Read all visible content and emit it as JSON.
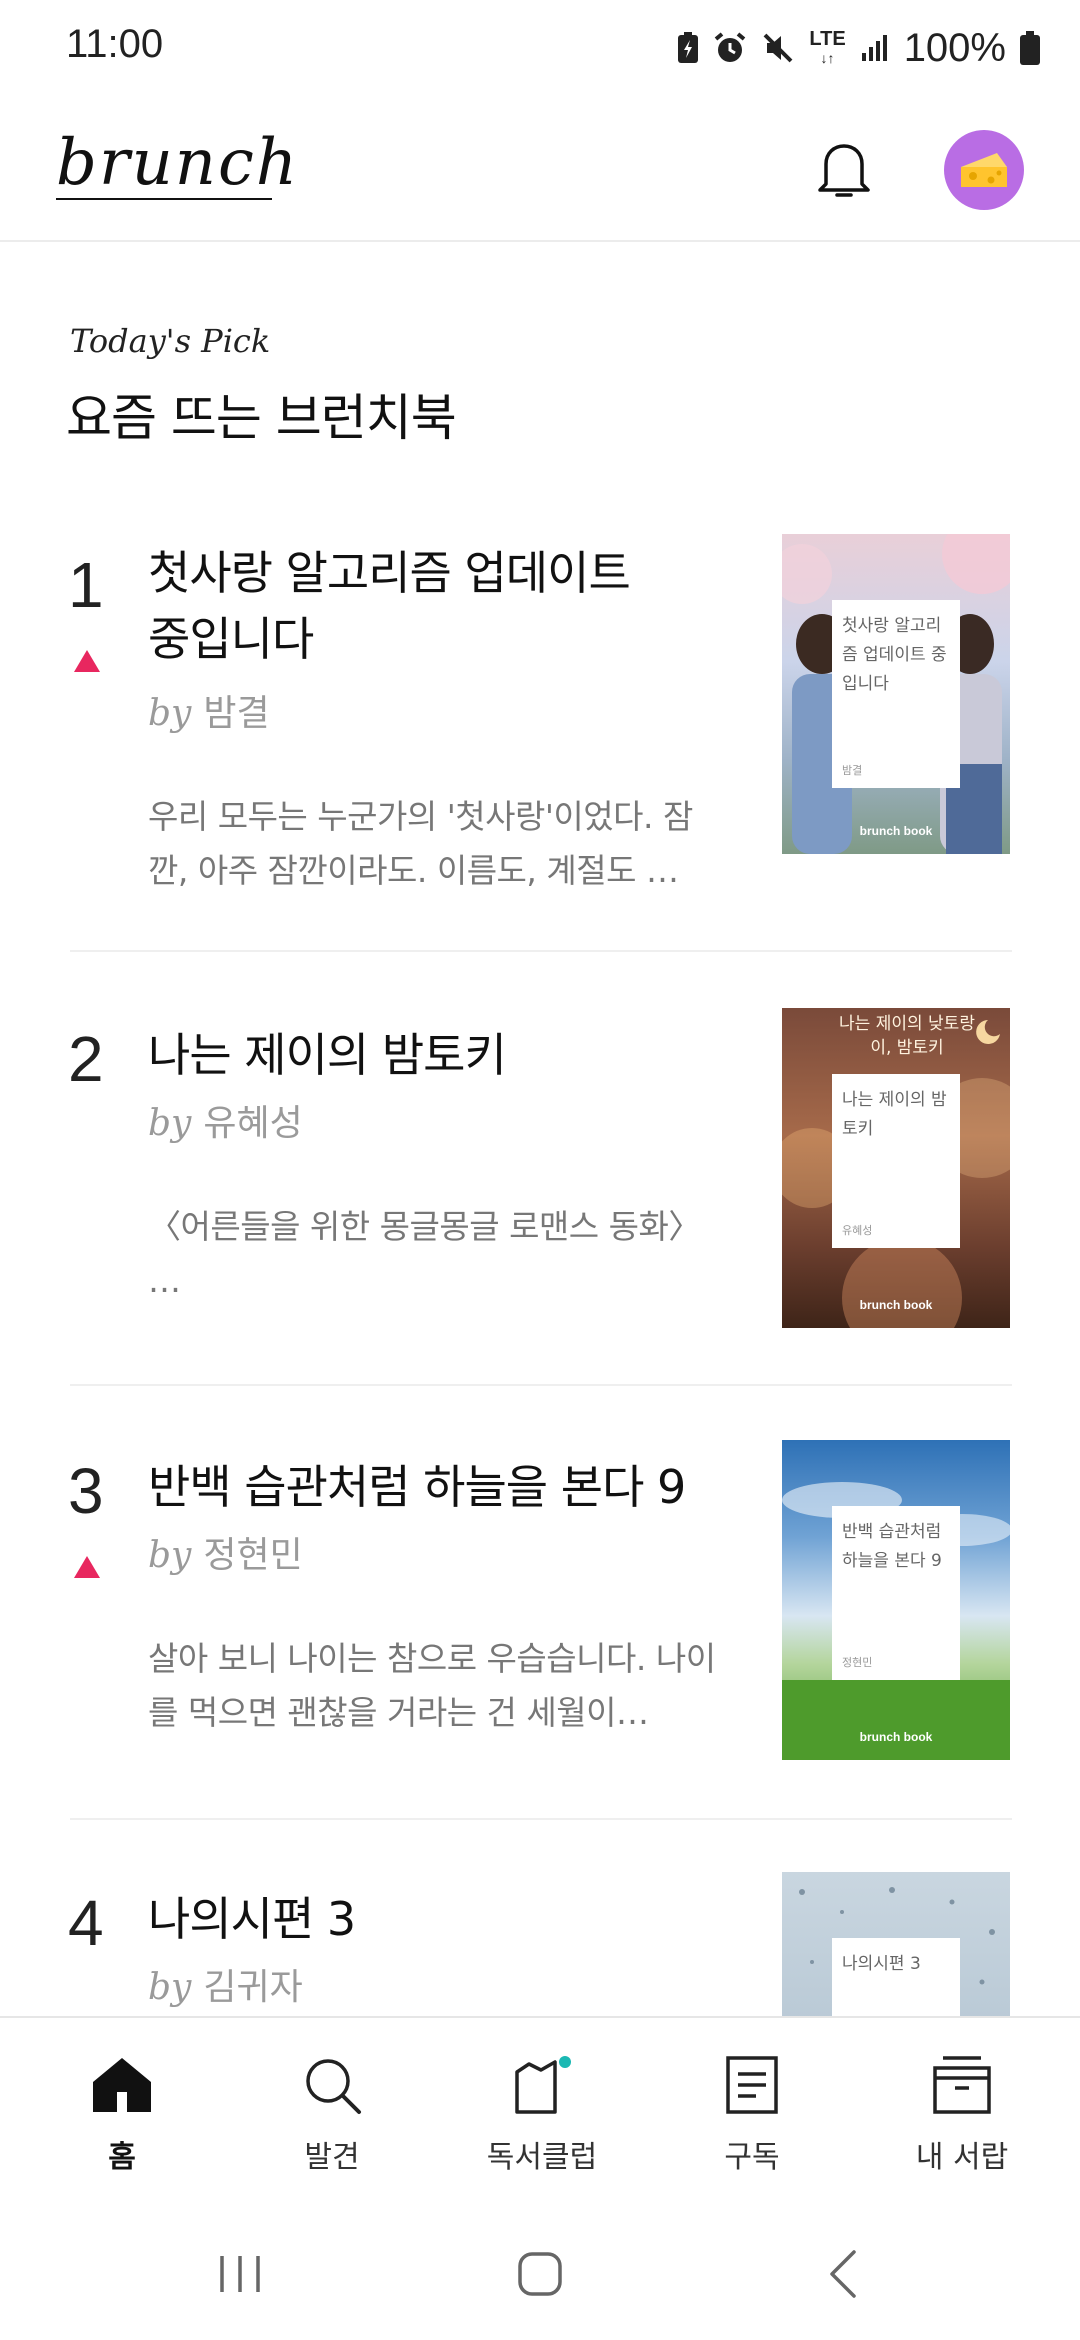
{
  "status_bar": {
    "time": "11:00",
    "network": "LTE",
    "battery": "100%",
    "icons": [
      "battery-saver-icon",
      "alarm-icon",
      "mute-icon",
      "lte-icon",
      "signal-icon",
      "battery-icon"
    ]
  },
  "header": {
    "logo": "brunch",
    "notification_icon": "bell-icon",
    "avatar_icon": "cheese-icon",
    "avatar_color": "#b96de4"
  },
  "section": {
    "label": "Today's Pick",
    "title": "요즘 뜨는 브런치북"
  },
  "items": [
    {
      "rank": "1",
      "trend": "up",
      "title": "첫사랑 알고리즘 업데이트 중입니다",
      "by": "by",
      "author": "밤결",
      "desc": "우리 모두는 누군가의 '첫사랑'이었다. 잠깐, 아주 잠깐이라도. 이름도, 계절도 …",
      "cover_title": "첫사랑 알고리즘 업데이트 중입니다",
      "cover_author": "밤결",
      "cover_publisher": "brunch book"
    },
    {
      "rank": "2",
      "trend": "none",
      "title": "나는 제이의 밤토키",
      "by": "by",
      "author": "유혜성",
      "desc": "〈어른들을 위한 몽글몽글 로맨스 동화〉 …",
      "cover_top_text": "나는 제이의 낮토랑이, 밤토키",
      "cover_title": "나는 제이의 밤토키",
      "cover_author": "유혜성",
      "cover_publisher": "brunch book"
    },
    {
      "rank": "3",
      "trend": "up",
      "title": "반백 습관처럼 하늘을 본다 9",
      "by": "by",
      "author": "정현민",
      "desc": "살아 보니 나이는 참으로 우습습니다. 나이를 먹으면 괜찮을 거라는 건 세월이…",
      "cover_title": "반백 습관처럼 하늘을 본다 9",
      "cover_author": "정현민",
      "cover_publisher": "brunch book"
    },
    {
      "rank": "4",
      "trend": "none",
      "title": "나의시편 3",
      "by": "by",
      "author": "김귀자",
      "cover_title": "나의시편 3"
    }
  ],
  "bottom_nav": [
    {
      "label": "홈",
      "icon": "home-icon",
      "active": true
    },
    {
      "label": "발견",
      "icon": "search-icon",
      "active": false
    },
    {
      "label": "독서클럽",
      "icon": "book-club-icon",
      "active": false
    },
    {
      "label": "구독",
      "icon": "subscribe-icon",
      "active": false
    },
    {
      "label": "내 서랍",
      "icon": "drawer-icon",
      "active": false
    }
  ],
  "colors": {
    "trend_up": "#e8275f",
    "badge_dot": "#1bb8b3"
  }
}
